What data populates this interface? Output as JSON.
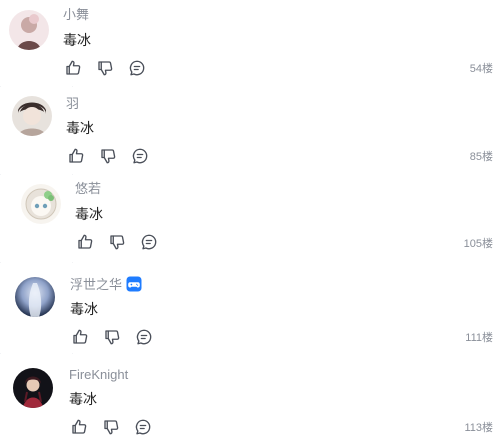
{
  "comments": [
    {
      "username": "小舞",
      "content": "毒冰",
      "floor": "54楼",
      "has_badge": false,
      "avatar_colors": [
        "#f3e6e8",
        "#c9a9a6",
        "#6b4a4a"
      ]
    },
    {
      "username": "羽",
      "content": "毒冰",
      "floor": "85楼",
      "has_badge": false,
      "avatar_colors": [
        "#e7e2dd",
        "#3a2e2c",
        "#b6a59c"
      ]
    },
    {
      "username": "悠若",
      "content": "毒冰",
      "floor": "105楼",
      "has_badge": false,
      "avatar_colors": [
        "#f7f4ef",
        "#8fcf8a",
        "#d9d2c5"
      ]
    },
    {
      "username": "浮世之华",
      "content": "毒冰",
      "floor": "111楼",
      "has_badge": true,
      "avatar_colors": [
        "#1d2b48",
        "#8fa2c9",
        "#dfe6f3"
      ]
    },
    {
      "username": "FireKnight",
      "content": "毒冰",
      "floor": "113楼",
      "has_badge": false,
      "avatar_colors": [
        "#121218",
        "#a0293b",
        "#e6c9b5"
      ]
    }
  ],
  "icons": {
    "like": "thumbs-up-icon",
    "dislike": "thumbs-down-icon",
    "reply": "comment-icon",
    "badge": "gamepad-badge-icon"
  },
  "colors": {
    "icon_stroke": "#4a4f59",
    "username": "#8a8f99",
    "content": "#222222",
    "floor": "#8a8f99",
    "badge": "#1f7cff"
  }
}
